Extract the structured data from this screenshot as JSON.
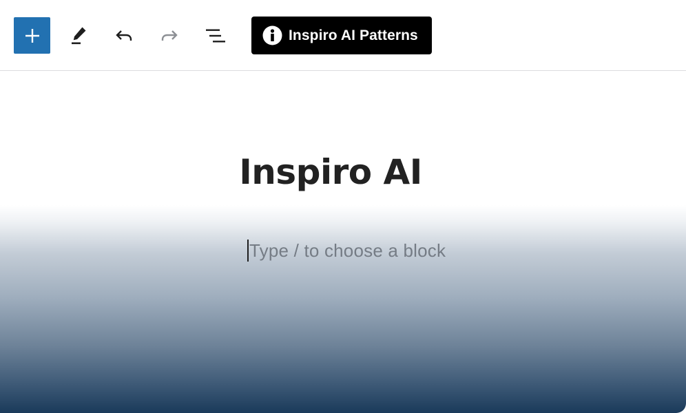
{
  "toolbar": {
    "add_block": {
      "icon": "plus-icon",
      "accent": "#2271b1"
    },
    "tools_icon": "pencil-icon",
    "undo_icon": "undo-icon",
    "redo_icon": "redo-icon",
    "list_view_icon": "list-view-icon",
    "patterns_button": {
      "icon": "info-icon",
      "label": "Inspiro AI Patterns",
      "background": "#000000"
    }
  },
  "editor": {
    "title": "Inspiro AI",
    "block_placeholder": "Type / to choose a block",
    "background_gradient": [
      "#ffffff",
      "#1a3a5a"
    ]
  }
}
